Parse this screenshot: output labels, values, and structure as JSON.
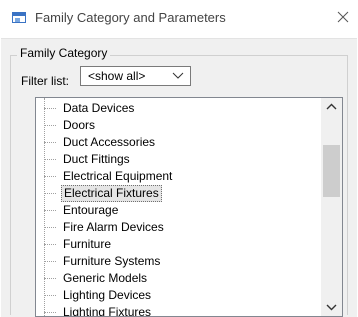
{
  "window": {
    "title": "Family Category and Parameters",
    "close_icon": "close-icon"
  },
  "family_category": {
    "group_label": "Family Category",
    "filter_label": "Filter list:",
    "filter_value": "<show all>",
    "items": [
      {
        "label": "Data Devices",
        "selected": false
      },
      {
        "label": "Doors",
        "selected": false
      },
      {
        "label": "Duct Accessories",
        "selected": false
      },
      {
        "label": "Duct Fittings",
        "selected": false
      },
      {
        "label": "Electrical Equipment",
        "selected": false
      },
      {
        "label": "Electrical Fixtures",
        "selected": true
      },
      {
        "label": "Entourage",
        "selected": false
      },
      {
        "label": "Fire Alarm Devices",
        "selected": false
      },
      {
        "label": "Furniture",
        "selected": false
      },
      {
        "label": "Furniture Systems",
        "selected": false
      },
      {
        "label": "Generic Models",
        "selected": false
      },
      {
        "label": "Lighting Devices",
        "selected": false
      },
      {
        "label": "Lighting Fixtures",
        "selected": false
      }
    ]
  }
}
